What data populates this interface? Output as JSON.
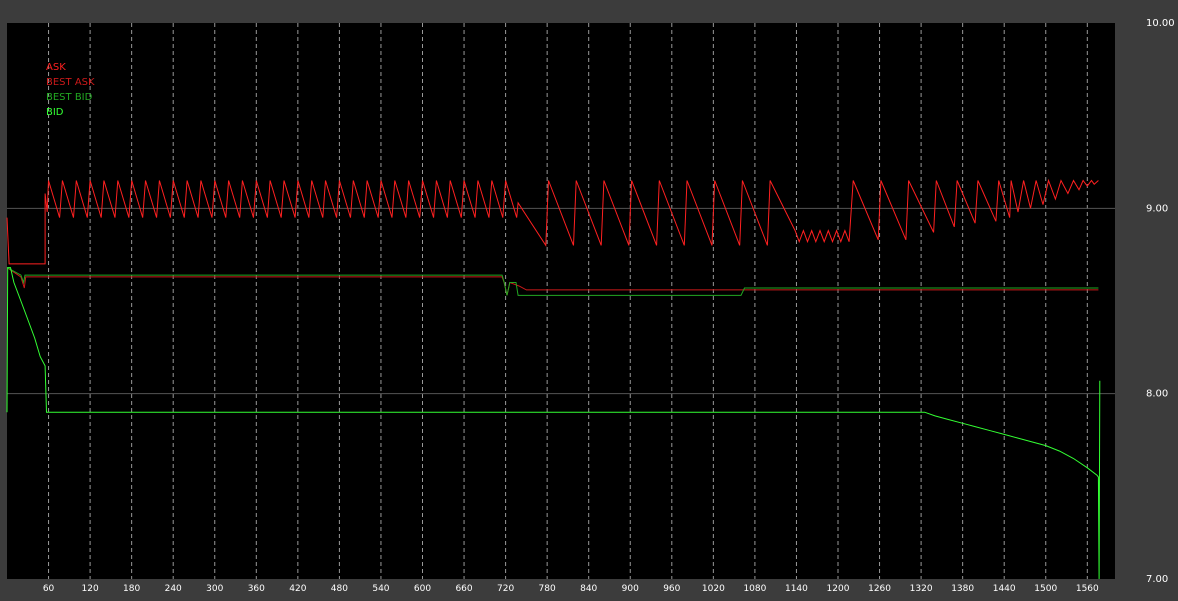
{
  "chart_data": {
    "type": "line",
    "title": "",
    "xlabel": "",
    "ylabel": "",
    "xlim": [
      0,
      1600
    ],
    "ylim": [
      7.0,
      10.0
    ],
    "x_ticks": [
      60,
      120,
      180,
      240,
      300,
      360,
      420,
      480,
      540,
      600,
      660,
      720,
      780,
      840,
      900,
      960,
      1020,
      1080,
      1140,
      1200,
      1260,
      1320,
      1380,
      1440,
      1500,
      1560
    ],
    "y_ticks": [
      {
        "value": 7.0,
        "label": "7.00"
      },
      {
        "value": 8.0,
        "label": "8.00"
      },
      {
        "value": 9.0,
        "label": "9.00"
      },
      {
        "value": 10.0,
        "label": "10.00"
      }
    ],
    "grid": {
      "vertical": "dashed",
      "horizontal": "solid"
    },
    "legend_position": "top-left",
    "colors": {
      "background": "#000000",
      "frame": "#3c3c3c",
      "axis_text": "#ffffff",
      "grid_v": "#cccccc",
      "grid_h": "#555555"
    },
    "series": [
      {
        "name": "ASK",
        "color": "#ff2020",
        "points": [
          [
            0,
            8.95
          ],
          [
            3,
            8.7
          ],
          [
            55,
            8.7
          ],
          [
            55,
            9.08
          ],
          [
            58,
            8.98
          ],
          [
            60,
            9.15
          ],
          [
            76,
            8.95
          ],
          [
            80,
            9.15
          ],
          [
            96,
            8.95
          ],
          [
            100,
            9.15
          ],
          [
            116,
            8.95
          ],
          [
            120,
            9.15
          ],
          [
            136,
            8.95
          ],
          [
            140,
            9.15
          ],
          [
            156,
            8.95
          ],
          [
            160,
            9.15
          ],
          [
            176,
            8.95
          ],
          [
            180,
            9.15
          ],
          [
            196,
            8.95
          ],
          [
            200,
            9.15
          ],
          [
            216,
            8.95
          ],
          [
            220,
            9.15
          ],
          [
            236,
            8.95
          ],
          [
            240,
            9.15
          ],
          [
            256,
            8.95
          ],
          [
            260,
            9.15
          ],
          [
            276,
            8.95
          ],
          [
            280,
            9.15
          ],
          [
            296,
            8.95
          ],
          [
            300,
            9.15
          ],
          [
            316,
            8.95
          ],
          [
            320,
            9.15
          ],
          [
            336,
            8.95
          ],
          [
            340,
            9.15
          ],
          [
            356,
            8.95
          ],
          [
            360,
            9.15
          ],
          [
            376,
            8.95
          ],
          [
            380,
            9.15
          ],
          [
            396,
            8.95
          ],
          [
            400,
            9.15
          ],
          [
            416,
            8.95
          ],
          [
            420,
            9.15
          ],
          [
            436,
            8.95
          ],
          [
            440,
            9.15
          ],
          [
            456,
            8.95
          ],
          [
            460,
            9.15
          ],
          [
            476,
            8.95
          ],
          [
            480,
            9.15
          ],
          [
            496,
            8.95
          ],
          [
            500,
            9.15
          ],
          [
            516,
            8.95
          ],
          [
            520,
            9.15
          ],
          [
            536,
            8.95
          ],
          [
            540,
            9.15
          ],
          [
            556,
            8.95
          ],
          [
            560,
            9.15
          ],
          [
            576,
            8.95
          ],
          [
            580,
            9.15
          ],
          [
            596,
            8.95
          ],
          [
            600,
            9.15
          ],
          [
            616,
            8.95
          ],
          [
            620,
            9.15
          ],
          [
            636,
            8.95
          ],
          [
            640,
            9.15
          ],
          [
            656,
            8.95
          ],
          [
            660,
            9.15
          ],
          [
            676,
            8.95
          ],
          [
            680,
            9.15
          ],
          [
            696,
            8.95
          ],
          [
            700,
            9.15
          ],
          [
            716,
            8.95
          ],
          [
            720,
            9.15
          ],
          [
            736,
            8.95
          ],
          [
            738,
            9.03
          ],
          [
            778,
            8.8
          ],
          [
            782,
            9.15
          ],
          [
            818,
            8.8
          ],
          [
            822,
            9.15
          ],
          [
            858,
            8.8
          ],
          [
            862,
            9.15
          ],
          [
            898,
            8.8
          ],
          [
            902,
            9.15
          ],
          [
            938,
            8.8
          ],
          [
            942,
            9.15
          ],
          [
            978,
            8.8
          ],
          [
            982,
            9.15
          ],
          [
            1018,
            8.8
          ],
          [
            1022,
            9.15
          ],
          [
            1058,
            8.8
          ],
          [
            1062,
            9.15
          ],
          [
            1098,
            8.8
          ],
          [
            1102,
            9.15
          ],
          [
            1138,
            8.88
          ],
          [
            1144,
            8.82
          ],
          [
            1150,
            8.88
          ],
          [
            1156,
            8.82
          ],
          [
            1162,
            8.88
          ],
          [
            1168,
            8.82
          ],
          [
            1174,
            8.88
          ],
          [
            1180,
            8.82
          ],
          [
            1186,
            8.88
          ],
          [
            1192,
            8.82
          ],
          [
            1198,
            8.88
          ],
          [
            1204,
            8.82
          ],
          [
            1210,
            8.88
          ],
          [
            1216,
            8.82
          ],
          [
            1222,
            9.15
          ],
          [
            1258,
            8.83
          ],
          [
            1262,
            9.15
          ],
          [
            1298,
            8.83
          ],
          [
            1302,
            9.15
          ],
          [
            1338,
            8.87
          ],
          [
            1342,
            9.15
          ],
          [
            1368,
            8.9
          ],
          [
            1372,
            9.15
          ],
          [
            1398,
            8.92
          ],
          [
            1402,
            9.15
          ],
          [
            1428,
            8.93
          ],
          [
            1432,
            9.15
          ],
          [
            1448,
            8.95
          ],
          [
            1450,
            9.15
          ],
          [
            1460,
            8.98
          ],
          [
            1468,
            9.15
          ],
          [
            1478,
            9.0
          ],
          [
            1486,
            9.15
          ],
          [
            1496,
            9.02
          ],
          [
            1504,
            9.15
          ],
          [
            1514,
            9.05
          ],
          [
            1522,
            9.15
          ],
          [
            1532,
            9.08
          ],
          [
            1540,
            9.15
          ],
          [
            1548,
            9.1
          ],
          [
            1554,
            9.15
          ],
          [
            1560,
            9.12
          ],
          [
            1566,
            9.15
          ],
          [
            1570,
            9.13
          ],
          [
            1576,
            9.15
          ]
        ]
      },
      {
        "name": "BEST ASK",
        "color": "#cc1a1a",
        "points": [
          [
            0,
            8.68
          ],
          [
            20,
            8.63
          ],
          [
            25,
            8.57
          ],
          [
            27,
            8.63
          ],
          [
            55,
            8.63
          ],
          [
            60,
            8.63
          ],
          [
            715,
            8.63
          ],
          [
            718,
            8.6
          ],
          [
            722,
            8.53
          ],
          [
            726,
            8.6
          ],
          [
            740,
            8.58
          ],
          [
            750,
            8.56
          ],
          [
            1576,
            8.56
          ]
        ]
      },
      {
        "name": "BEST BID",
        "color": "#22a822",
        "points": [
          [
            0,
            8.68
          ],
          [
            20,
            8.64
          ],
          [
            24,
            8.6
          ],
          [
            26,
            8.64
          ],
          [
            55,
            8.64
          ],
          [
            60,
            8.64
          ],
          [
            715,
            8.64
          ],
          [
            718,
            8.6
          ],
          [
            722,
            8.53
          ],
          [
            726,
            8.6
          ],
          [
            735,
            8.6
          ],
          [
            738,
            8.53
          ],
          [
            1060,
            8.53
          ],
          [
            1065,
            8.57
          ],
          [
            1576,
            8.57
          ]
        ]
      },
      {
        "name": "BID",
        "color": "#33ff33",
        "points": [
          [
            0,
            7.9
          ],
          [
            1,
            8.68
          ],
          [
            5,
            8.68
          ],
          [
            10,
            8.6
          ],
          [
            20,
            8.5
          ],
          [
            30,
            8.4
          ],
          [
            40,
            8.3
          ],
          [
            48,
            8.2
          ],
          [
            55,
            8.15
          ],
          [
            57,
            7.9
          ],
          [
            60,
            7.9
          ],
          [
            1325,
            7.9
          ],
          [
            1340,
            7.88
          ],
          [
            1360,
            7.86
          ],
          [
            1380,
            7.84
          ],
          [
            1400,
            7.82
          ],
          [
            1420,
            7.8
          ],
          [
            1440,
            7.78
          ],
          [
            1460,
            7.76
          ],
          [
            1480,
            7.74
          ],
          [
            1500,
            7.72
          ],
          [
            1520,
            7.69
          ],
          [
            1540,
            7.65
          ],
          [
            1560,
            7.6
          ],
          [
            1574,
            7.56
          ],
          [
            1576,
            7.55
          ],
          [
            1577,
            7.0
          ],
          [
            1578,
            8.07
          ]
        ]
      }
    ]
  }
}
